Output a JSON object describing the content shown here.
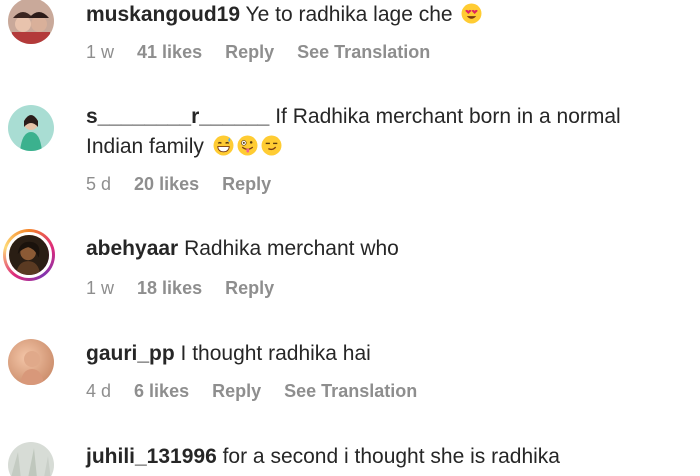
{
  "comments": [
    {
      "username": "muskangoud19",
      "text": "Ye to radhika lage che",
      "emoji": [
        "heart-eyes-emoji-icon"
      ],
      "time": "1 w",
      "likes": "41 likes",
      "reply": "Reply",
      "translation": "See Translation"
    },
    {
      "username": "s________r______",
      "text": "If Radhika merchant born in a normal",
      "text2": "Indian family",
      "emoji": [
        "grin-sweat-emoji-icon",
        "zany-face-emoji-icon",
        "smirk-emoji-icon"
      ],
      "time": "5 d",
      "likes": "20 likes",
      "reply": "Reply"
    },
    {
      "username": "abehyaar",
      "text": "Radhika merchant who",
      "time": "1 w",
      "likes": "18 likes",
      "reply": "Reply"
    },
    {
      "username": "gauri_pp",
      "text": "I thought radhika hai",
      "time": "4 d",
      "likes": "6 likes",
      "reply": "Reply",
      "translation": "See Translation"
    },
    {
      "username": "juhili_131996",
      "text": "for a second i thought she is radhika"
    }
  ],
  "colors": {
    "text": "#262626",
    "meta": "#8e8e8e"
  }
}
